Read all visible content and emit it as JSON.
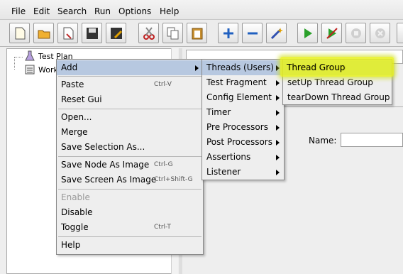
{
  "menubar": {
    "items": [
      {
        "label": "File"
      },
      {
        "label": "Edit"
      },
      {
        "label": "Search"
      },
      {
        "label": "Run"
      },
      {
        "label": "Options"
      },
      {
        "label": "Help"
      }
    ]
  },
  "toolbar": {
    "buttons": [
      {
        "icon": "new-document-icon"
      },
      {
        "icon": "open-folder-icon"
      },
      {
        "icon": "open-template-icon"
      },
      {
        "icon": "save-icon"
      },
      {
        "icon": "save-as-icon"
      },
      {
        "icon": "cut-icon"
      },
      {
        "icon": "copy-icon"
      },
      {
        "icon": "paste-icon"
      },
      {
        "icon": "expand-plus-icon"
      },
      {
        "icon": "collapse-minus-icon"
      },
      {
        "icon": "toggle-wand-icon"
      },
      {
        "icon": "run-start-icon"
      },
      {
        "icon": "start-no-pauses-icon"
      },
      {
        "icon": "stop-icon"
      },
      {
        "icon": "shutdown-icon"
      }
    ]
  },
  "tree": {
    "items": [
      {
        "label": "Test Plan"
      },
      {
        "label": "Work"
      }
    ]
  },
  "right_pane": {
    "name_label": "Name:"
  },
  "context_menu": {
    "items": [
      {
        "label": "Add",
        "submenu": true
      },
      {
        "label": "Paste",
        "accelerator": "Ctrl-V"
      },
      {
        "label": "Reset Gui"
      },
      {
        "label": "Open..."
      },
      {
        "label": "Merge"
      },
      {
        "label": "Save Selection As..."
      },
      {
        "label": "Save Node As Image",
        "accelerator": "Ctrl-G"
      },
      {
        "label": "Save Screen As Image",
        "accelerator": "Ctrl+Shift-G"
      },
      {
        "label": "Enable",
        "disabled": true
      },
      {
        "label": "Disable"
      },
      {
        "label": "Toggle",
        "accelerator": "Ctrl-T"
      },
      {
        "label": "Help"
      }
    ]
  },
  "add_submenu": {
    "items": [
      {
        "label": "Threads (Users)"
      },
      {
        "label": "Test Fragment"
      },
      {
        "label": "Config Element"
      },
      {
        "label": "Timer"
      },
      {
        "label": "Pre Processors"
      },
      {
        "label": "Post Processors"
      },
      {
        "label": "Assertions"
      },
      {
        "label": "Listener"
      }
    ]
  },
  "threads_submenu": {
    "items": [
      {
        "label": "Thread Group"
      },
      {
        "label": "setUp Thread Group"
      },
      {
        "label": "tearDown Thread Group"
      }
    ]
  },
  "colors": {
    "selection": "#b7c8e0",
    "highlight": "#e8f21c"
  }
}
